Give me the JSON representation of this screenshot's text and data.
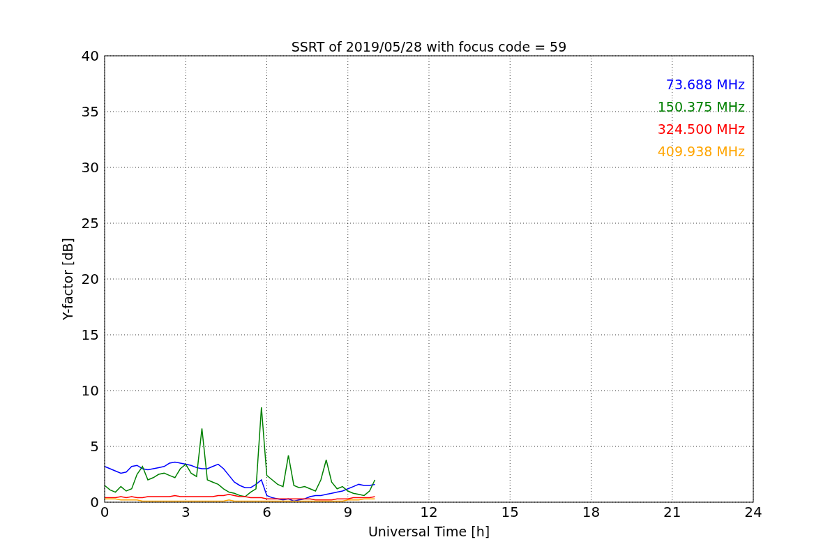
{
  "chart_data": {
    "type": "line",
    "title": "SSRT of 2019/05/28 with focus code = 59",
    "xlabel": "Universal Time [h]",
    "ylabel": "Y-factor [dB]",
    "x": [
      0,
      0.2,
      0.4,
      0.6,
      0.8,
      1,
      1.2,
      1.4,
      1.6,
      1.8,
      2,
      2.2,
      2.4,
      2.6,
      2.8,
      3,
      3.2,
      3.4,
      3.6,
      3.8,
      4,
      4.2,
      4.4,
      4.6,
      4.8,
      5,
      5.2,
      5.4,
      5.6,
      5.8,
      6,
      6.2,
      6.4,
      6.6,
      6.8,
      7,
      7.2,
      7.4,
      7.6,
      7.8,
      8,
      8.2,
      8.4,
      8.6,
      8.8,
      9,
      9.2,
      9.4,
      9.6,
      9.8,
      10
    ],
    "series": [
      {
        "name": "73.688 MHz",
        "color": "#0000ff",
        "values": [
          3.2,
          3.0,
          2.8,
          2.6,
          2.7,
          3.2,
          3.3,
          3.0,
          2.9,
          3.0,
          3.1,
          3.2,
          3.5,
          3.6,
          3.5,
          3.4,
          3.3,
          3.1,
          3.0,
          3.0,
          3.2,
          3.4,
          3.0,
          2.4,
          1.8,
          1.5,
          1.3,
          1.3,
          1.6,
          2.0,
          0.6,
          0.4,
          0.3,
          0.2,
          0.3,
          0.1,
          0.2,
          0.3,
          0.5,
          0.6,
          0.6,
          0.7,
          0.8,
          0.9,
          1.0,
          1.2,
          1.4,
          1.6,
          1.5,
          1.5,
          1.6
        ]
      },
      {
        "name": "150.375 MHz",
        "color": "#008000",
        "values": [
          1.5,
          1.1,
          0.9,
          1.4,
          1.0,
          1.2,
          2.5,
          3.2,
          2.0,
          2.2,
          2.5,
          2.6,
          2.4,
          2.2,
          3.0,
          3.4,
          2.6,
          2.3,
          6.6,
          2.0,
          1.8,
          1.6,
          1.2,
          0.9,
          0.8,
          0.6,
          0.5,
          0.9,
          1.2,
          8.5,
          2.4,
          2.0,
          1.6,
          1.4,
          4.2,
          1.5,
          1.3,
          1.4,
          1.2,
          1.0,
          2.0,
          3.8,
          1.8,
          1.2,
          1.4,
          1.0,
          0.8,
          0.7,
          0.6,
          1.0,
          2.0
        ]
      },
      {
        "name": "324.500 MHz",
        "color": "#ff0000",
        "values": [
          0.4,
          0.4,
          0.4,
          0.5,
          0.4,
          0.5,
          0.4,
          0.4,
          0.5,
          0.5,
          0.5,
          0.5,
          0.5,
          0.6,
          0.5,
          0.5,
          0.5,
          0.5,
          0.5,
          0.5,
          0.5,
          0.6,
          0.6,
          0.7,
          0.6,
          0.5,
          0.5,
          0.4,
          0.4,
          0.4,
          0.3,
          0.3,
          0.3,
          0.3,
          0.3,
          0.3,
          0.3,
          0.3,
          0.3,
          0.2,
          0.2,
          0.2,
          0.2,
          0.3,
          0.3,
          0.3,
          0.4,
          0.4,
          0.4,
          0.4,
          0.5
        ]
      },
      {
        "name": "409.938 MHz",
        "color": "#ffa500",
        "values": [
          0.3,
          0.3,
          0.3,
          0.2,
          0.2,
          0.2,
          0.2,
          0.1,
          0.1,
          0.1,
          0.1,
          0.1,
          0.1,
          0.1,
          0.1,
          0.1,
          0.1,
          0.1,
          0.1,
          0.1,
          0.1,
          0.1,
          0.1,
          0.2,
          0.1,
          0.1,
          0.1,
          0.1,
          0.1,
          0.1,
          0.1,
          0.1,
          0.1,
          0.1,
          0.1,
          0.1,
          0.1,
          0.1,
          0.1,
          0.1,
          0.1,
          0.1,
          0.1,
          0.1,
          0.1,
          0.2,
          0.2,
          0.2,
          0.3,
          0.3,
          0.3
        ]
      }
    ],
    "xlim": [
      0,
      24
    ],
    "ylim": [
      0,
      40
    ],
    "xticks": [
      0,
      3,
      6,
      9,
      12,
      15,
      18,
      21,
      24
    ],
    "yticks": [
      0,
      5,
      10,
      15,
      20,
      25,
      30,
      35,
      40
    ],
    "grid": true
  }
}
